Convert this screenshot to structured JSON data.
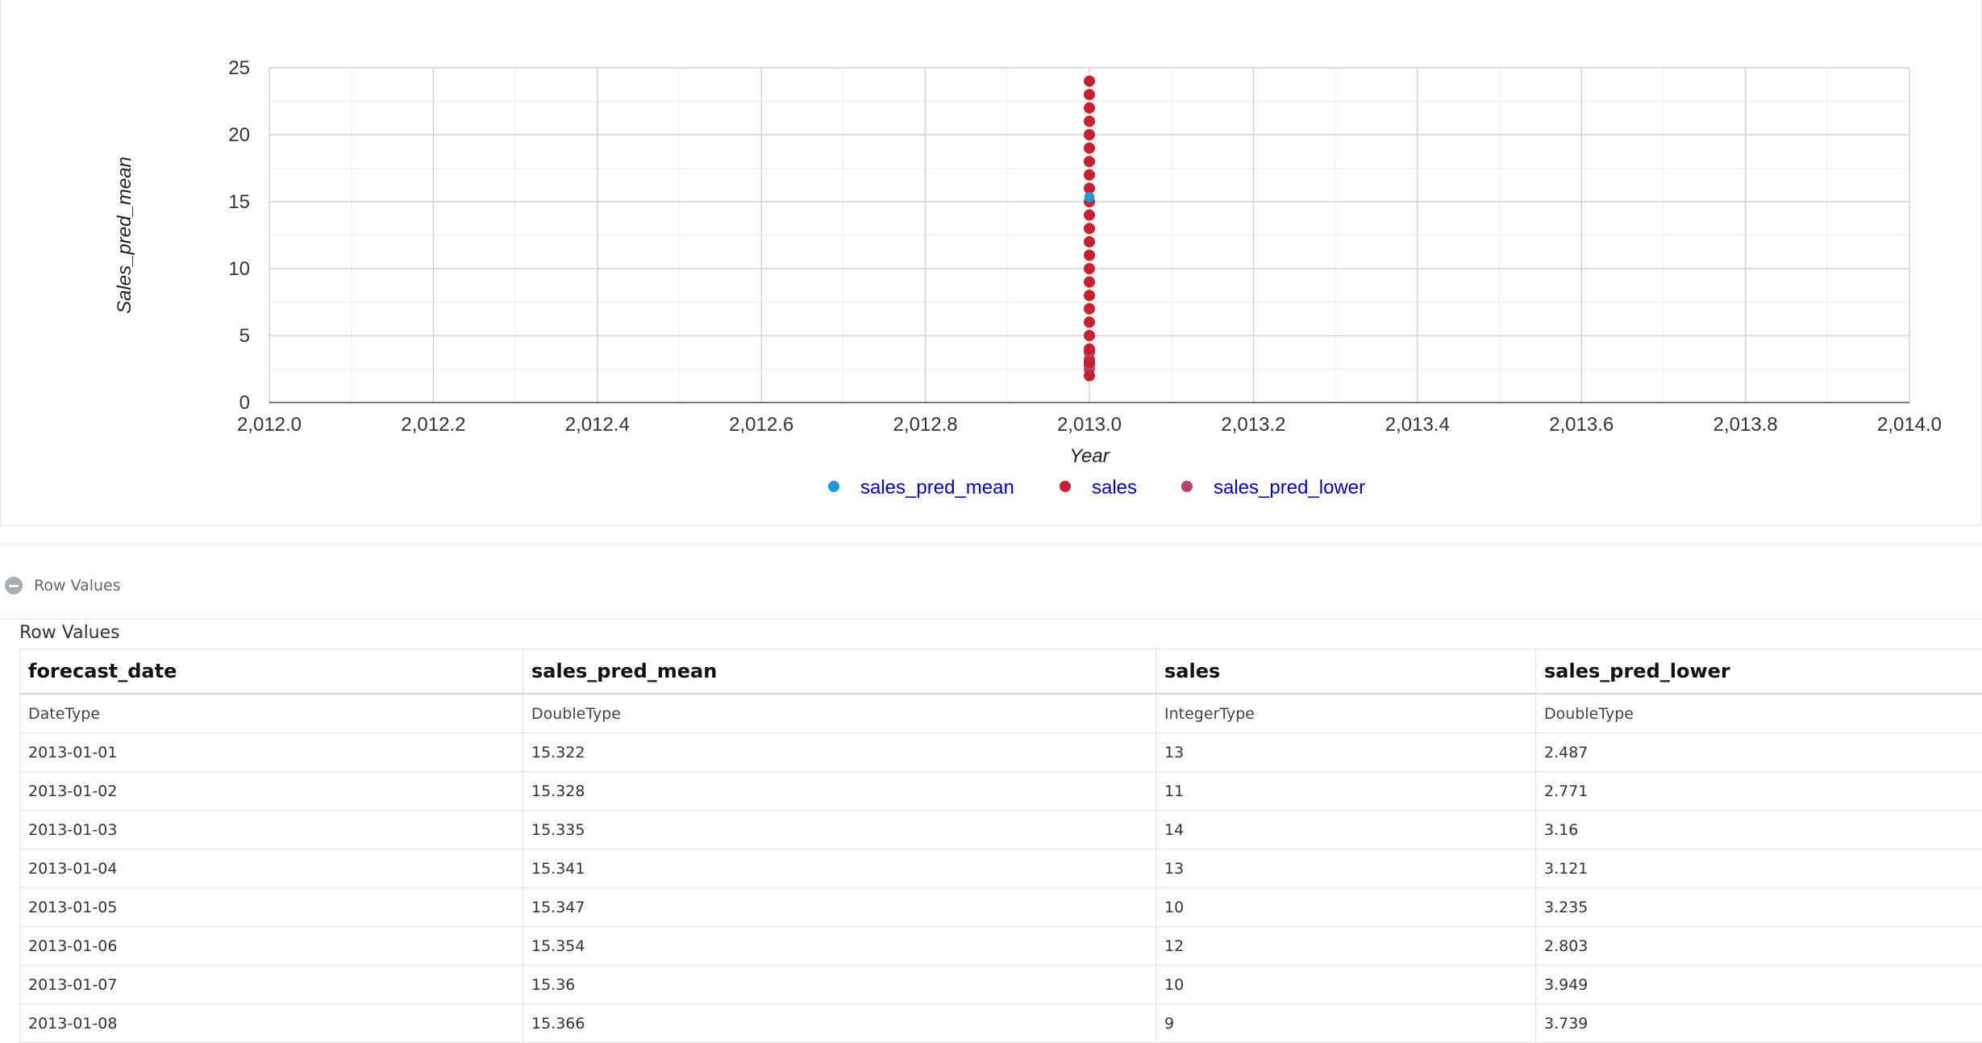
{
  "chart_data": {
    "type": "scatter",
    "title": "",
    "xlabel": "Year",
    "ylabel": "Sales_pred_mean",
    "xlim": [
      2012.0,
      2014.0
    ],
    "ylim": [
      0,
      25
    ],
    "x_ticks": [
      "2,012.0",
      "2,012.2",
      "2,012.4",
      "2,012.6",
      "2,012.8",
      "2,013.0",
      "2,013.2",
      "2,013.4",
      "2,013.6",
      "2,013.8",
      "2,014.0"
    ],
    "y_ticks": [
      "0",
      "5",
      "10",
      "15",
      "20",
      "25"
    ],
    "grid": true,
    "legend_position": "bottom",
    "series": [
      {
        "name": "sales_pred_mean",
        "color": "#1a9be0",
        "x": [
          2013.0,
          2013.0,
          2013.0,
          2013.0,
          2013.0,
          2013.0,
          2013.0,
          2013.0
        ],
        "y": [
          15.322,
          15.328,
          15.335,
          15.341,
          15.347,
          15.354,
          15.36,
          15.366
        ]
      },
      {
        "name": "sales",
        "color": "#cc1f2d",
        "x": [
          2013.0,
          2013.0,
          2013.0,
          2013.0,
          2013.0,
          2013.0,
          2013.0,
          2013.0,
          2013.0,
          2013.0,
          2013.0,
          2013.0,
          2013.0,
          2013.0,
          2013.0,
          2013.0,
          2013.0,
          2013.0,
          2013.0,
          2013.0,
          2013.0,
          2013.0,
          2013.0
        ],
        "y": [
          2,
          3,
          4,
          5,
          6,
          7,
          8,
          9,
          10,
          11,
          12,
          13,
          14,
          15,
          16,
          17,
          18,
          19,
          20,
          21,
          22,
          23,
          24
        ]
      },
      {
        "name": "sales_pred_lower",
        "color": "#b8426e",
        "x": [
          2013.0,
          2013.0,
          2013.0,
          2013.0,
          2013.0,
          2013.0,
          2013.0,
          2013.0
        ],
        "y": [
          2.487,
          2.771,
          3.16,
          3.121,
          3.235,
          2.803,
          3.949,
          3.739
        ]
      }
    ]
  },
  "section": {
    "title": "Row Values"
  },
  "table": {
    "title": "Row Values",
    "columns": [
      "forecast_date",
      "sales_pred_mean",
      "sales",
      "sales_pred_lower"
    ],
    "types": [
      "DateType",
      "DoubleType",
      "IntegerType",
      "DoubleType"
    ],
    "rows": [
      [
        "2013-01-01",
        "15.322",
        "13",
        "2.487"
      ],
      [
        "2013-01-02",
        "15.328",
        "11",
        "2.771"
      ],
      [
        "2013-01-03",
        "15.335",
        "14",
        "3.16"
      ],
      [
        "2013-01-04",
        "15.341",
        "13",
        "3.121"
      ],
      [
        "2013-01-05",
        "15.347",
        "10",
        "3.235"
      ],
      [
        "2013-01-06",
        "15.354",
        "12",
        "2.803"
      ],
      [
        "2013-01-07",
        "15.36",
        "10",
        "3.949"
      ],
      [
        "2013-01-08",
        "15.366",
        "9",
        "3.739"
      ]
    ]
  }
}
